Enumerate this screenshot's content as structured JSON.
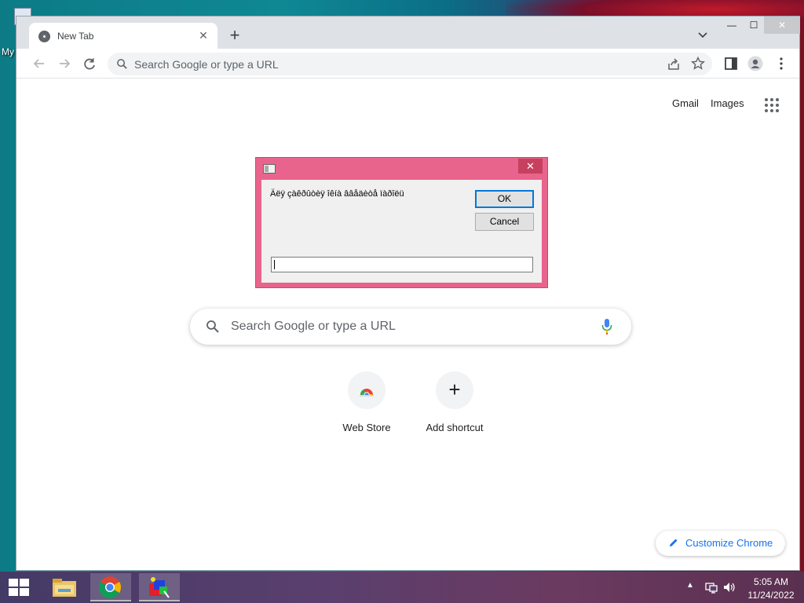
{
  "desktop": {
    "icon_label": "My"
  },
  "browser": {
    "tab": {
      "title": "New Tab",
      "favicon": "chrome-icon"
    },
    "omnibox": {
      "placeholder": "Search Google or type a URL"
    },
    "ntp": {
      "gmail_label": "Gmail",
      "images_label": "Images",
      "search_placeholder": "Search Google or type a URL",
      "shortcuts": [
        {
          "label": "Web Store",
          "icon": "web-store-icon"
        },
        {
          "label": "Add shortcut",
          "icon": "plus-icon"
        }
      ],
      "customize_label": "Customize Chrome"
    }
  },
  "dialog": {
    "prompt": "Äëÿ çàêðûòèÿ îêíà ââåäèòå ïàðîëü",
    "ok_label": "OK",
    "cancel_label": "Cancel",
    "close_glyph": "✕",
    "input_value": ""
  },
  "taskbar": {
    "apps": [
      "file-explorer-icon",
      "chrome-icon",
      "paint-app-icon"
    ],
    "time": "5:05 AM",
    "date": "11/24/2022"
  },
  "colors": {
    "dialog_frame": "#e8648c",
    "accent_blue": "#1a73e8",
    "ok_border": "#0078d7"
  }
}
